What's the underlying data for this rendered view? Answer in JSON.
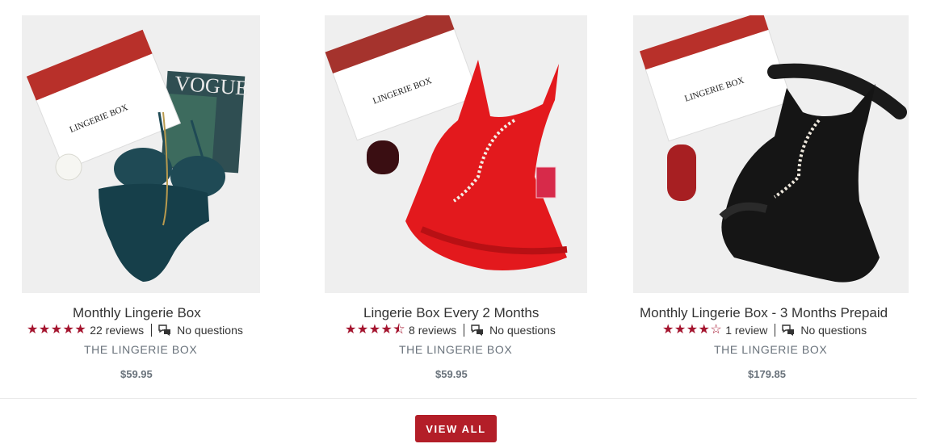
{
  "products": [
    {
      "title": "Monthly Lingerie Box",
      "rating": 5,
      "stars": "★★★★★",
      "reviews": "22 reviews",
      "questions": "No questions",
      "vendor": "THE LINGERIE BOX",
      "price": "$59.95",
      "image_logo_text": "LINGERIE BOX",
      "image_magazine_text": "VOGUE"
    },
    {
      "title": "Lingerie Box Every 2 Months",
      "rating": 4.5,
      "stars": "★★★★⯪",
      "reviews": "8 reviews",
      "questions": "No questions",
      "vendor": "THE LINGERIE BOX",
      "price": "$59.95",
      "image_logo_text": "LINGERIE BOX"
    },
    {
      "title": "Monthly Lingerie Box - 3 Months Prepaid",
      "rating": 4,
      "stars": "★★★★☆",
      "reviews": "1 review",
      "questions": "No questions",
      "vendor": "THE LINGERIE BOX",
      "price": "$179.85",
      "image_logo_text": "LINGERIE BOX"
    }
  ],
  "view_all_label": "VIEW ALL",
  "colors": {
    "star": "#a4142e",
    "button": "#b31e28",
    "vendor": "#69727b"
  },
  "icons": {
    "questions": "chat-bubbles-icon",
    "star": "star-icon"
  }
}
